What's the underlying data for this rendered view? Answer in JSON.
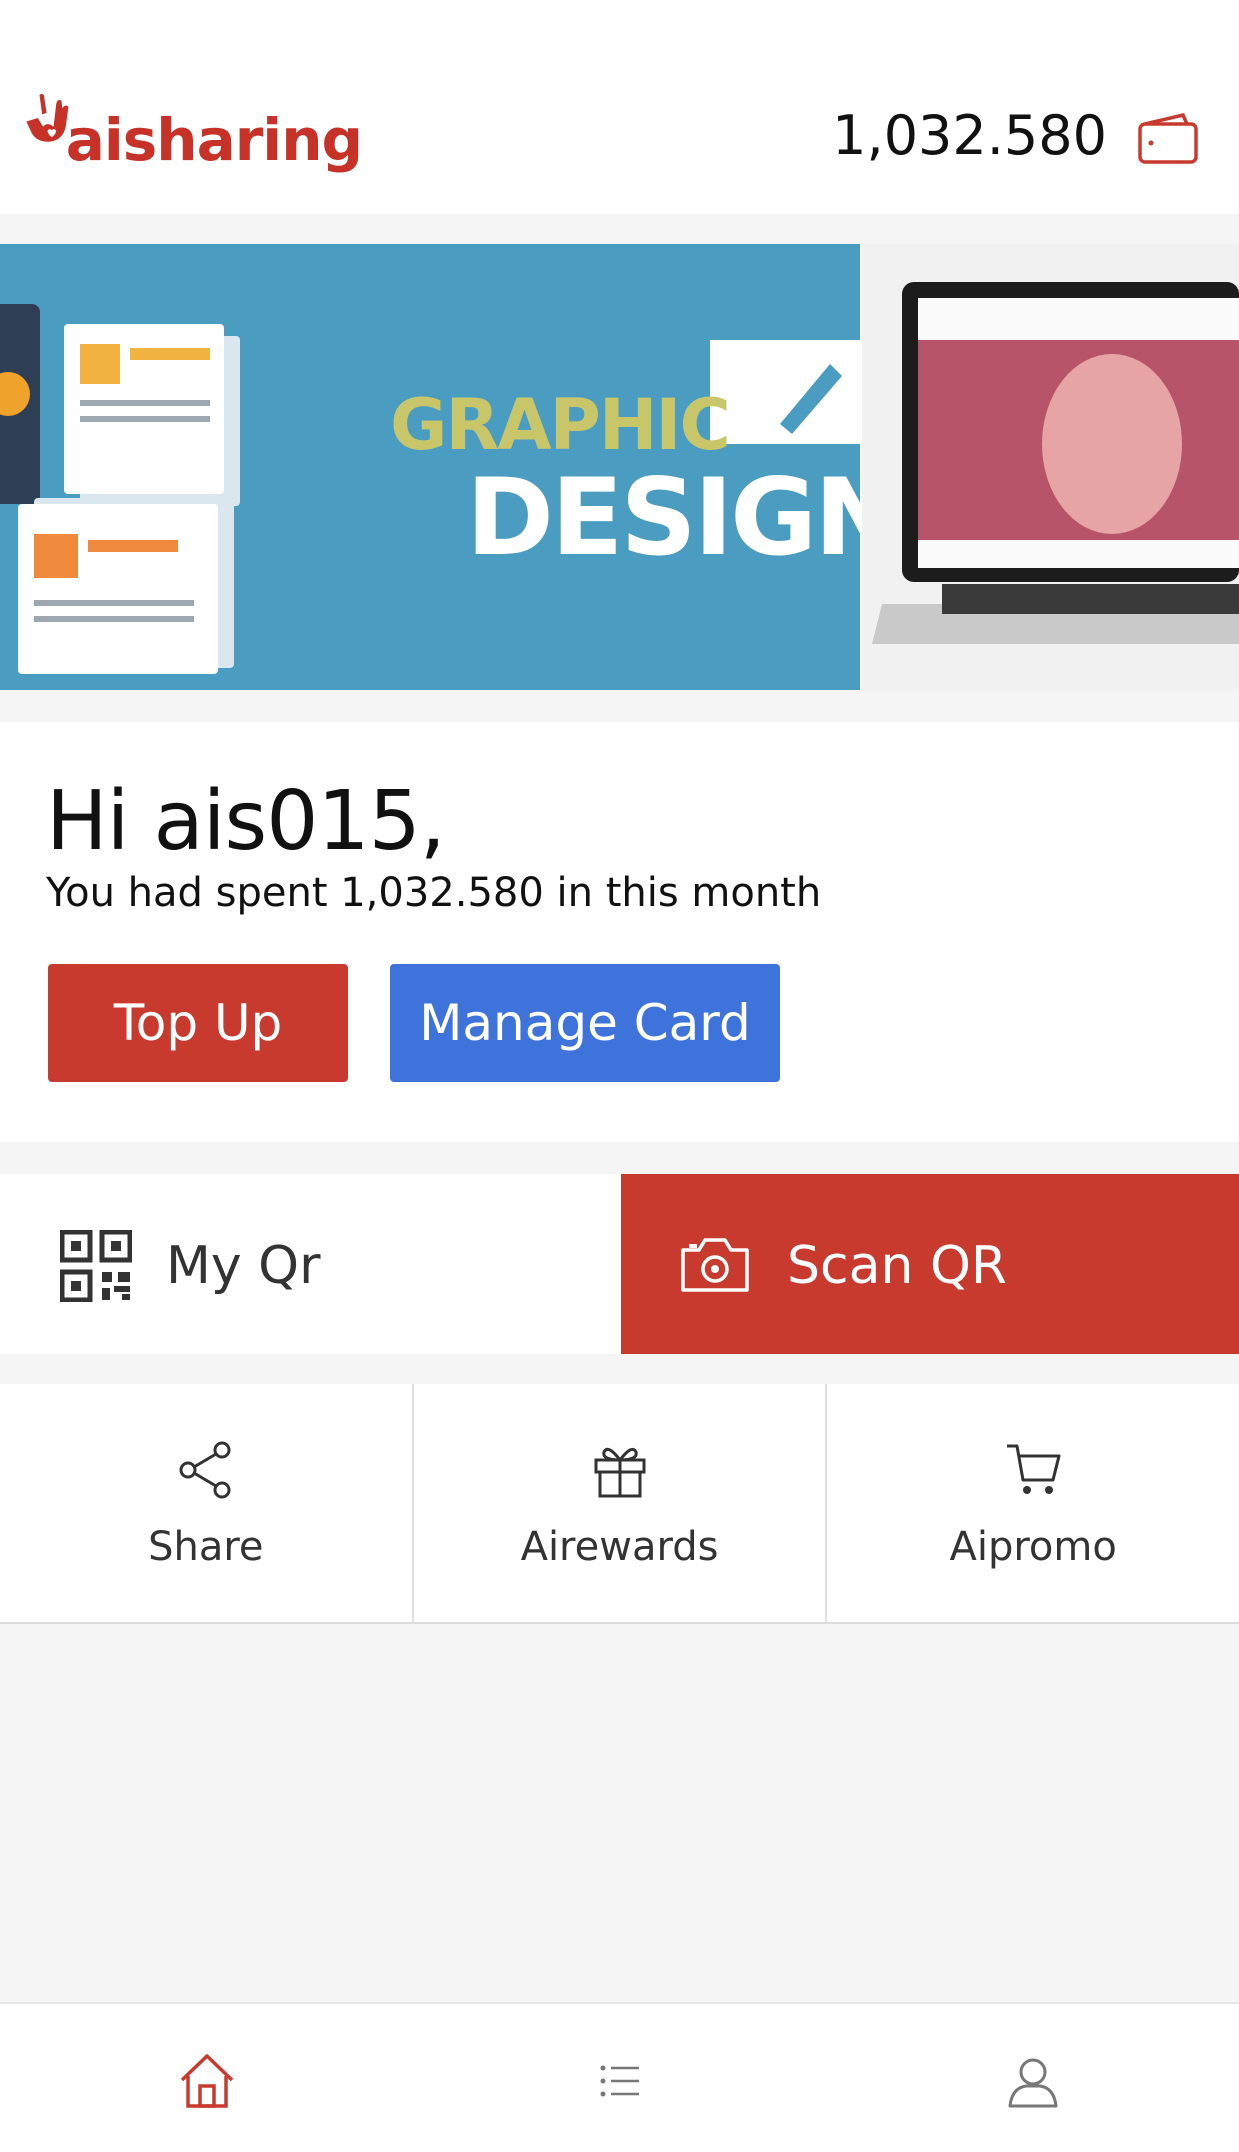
{
  "header": {
    "logo_text": "aisharing",
    "balance": "1,032.580",
    "wallet_icon": "wallet-icon"
  },
  "banner": {
    "slide1_line1": "GRAPHIC",
    "slide1_line2": "DESIGN"
  },
  "greeting": {
    "title": "Hi ais015,",
    "subtitle": "You had spent 1,032.580 in this month",
    "topup_label": "Top Up",
    "manage_label": "Manage Card"
  },
  "qr": {
    "my_qr_label": "My Qr",
    "scan_label": "Scan QR"
  },
  "shortcuts": [
    {
      "label": "Share",
      "icon": "share-icon"
    },
    {
      "label": "Airewards",
      "icon": "gift-icon"
    },
    {
      "label": "Aipromo",
      "icon": "cart-icon"
    }
  ],
  "bottom_nav": [
    {
      "icon": "home-icon",
      "active": true
    },
    {
      "icon": "list-icon",
      "active": false
    },
    {
      "icon": "user-icon",
      "active": false
    }
  ],
  "colors": {
    "brand_red": "#c73a2d",
    "brand_blue": "#3f73dc"
  }
}
